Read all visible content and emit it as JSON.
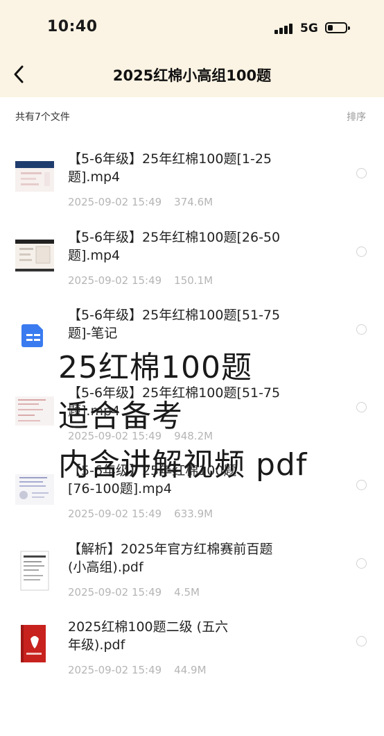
{
  "status_bar": {
    "time": "10:40",
    "network": "5G"
  },
  "header": {
    "title": "2025红棉小高组100题"
  },
  "toolbar": {
    "count_label": "共有7个文件",
    "sort_label": "排序"
  },
  "files": [
    {
      "name": "【5-6年级】25年红棉100题[1-25\n题].mp4",
      "date": "2025-09-02 15:49",
      "size": "374.6M",
      "icon": "video-thumbnail"
    },
    {
      "name": "【5-6年级】25年红棉100题[26-50\n题].mp4",
      "date": "2025-09-02 15:49",
      "size": "150.1M",
      "icon": "video-thumbnail"
    },
    {
      "name": "【5-6年级】25年红棉100题[51-75\n题]-笔记",
      "date": "",
      "size": "",
      "icon": "note-icon"
    },
    {
      "name": "【5-6年级】25年红棉100题[51-75\n题].mp4",
      "date": "2025-09-02 15:49",
      "size": "948.2M",
      "icon": "video-thumbnail"
    },
    {
      "name": "【5-6年级】25年红棉100题\n[76-100题].mp4",
      "date": "2025-09-02 15:49",
      "size": "633.9M",
      "icon": "video-thumbnail"
    },
    {
      "name": "【解析】2025年官方红棉赛前百题\n(小高组).pdf",
      "date": "2025-09-02 15:49",
      "size": "4.5M",
      "icon": "pdf-thumbnail"
    },
    {
      "name": "2025红棉100题二级 (五六\n年级).pdf",
      "date": "2025-09-02 15:49",
      "size": "44.9M",
      "icon": "pdf-cover-thumbnail"
    }
  ],
  "overlay": {
    "line1": "25红棉100题",
    "line2": "适合备考",
    "line3": "内含讲解视频 pdf"
  },
  "colors": {
    "header_bg": "#fbf3e3",
    "meta_text": "#b5b5b5",
    "note_icon": "#3a7bf0"
  }
}
